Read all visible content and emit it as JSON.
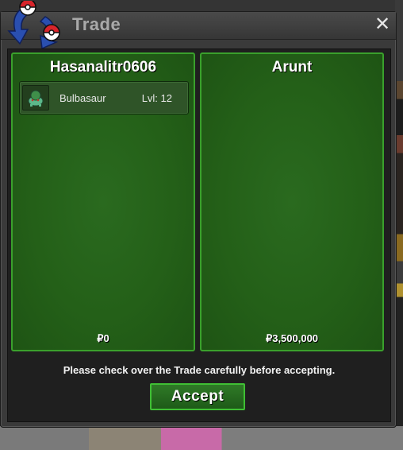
{
  "window": {
    "title": "Trade",
    "close_glyph": "✕"
  },
  "logo": {
    "icon": "pokeball-swap-icon"
  },
  "left_panel": {
    "player_name": "Hasanalitr0606",
    "items": [
      {
        "icon": "bulbasaur-icon",
        "name": "Bulbasaur",
        "level": "Lvl: 12"
      }
    ],
    "money": "₽0"
  },
  "right_panel": {
    "player_name": "Arunt",
    "items": [],
    "money": "₽3,500,000"
  },
  "notice": "Please check over the Trade carefully before accepting.",
  "accept_button": {
    "label": "Accept"
  },
  "colors": {
    "panel_green": "#246018",
    "panel_border": "#3aa02c",
    "accept_border": "#3fbf34",
    "window_bg": "#3a3a3a"
  }
}
